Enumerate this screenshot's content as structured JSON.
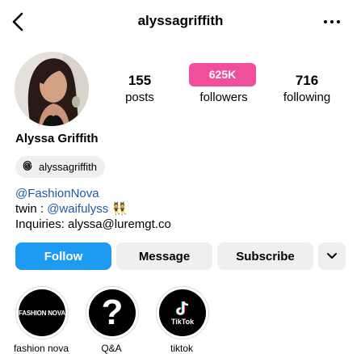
{
  "header": {
    "username": "alyssagriffith"
  },
  "stats": {
    "posts_count": "155",
    "posts_label": "posts",
    "followers_count": "625K",
    "followers_label": "followers",
    "following_count": "716",
    "following_label": "following"
  },
  "profile": {
    "name": "Alyssa Griffith",
    "threads_handle": "alyssagriffith",
    "bio_line1": "@FashionNova",
    "bio_line2_prefix": "twin : ",
    "bio_line2_link": "@waifulyss",
    "bio_line2_emoji": "👯",
    "bio_line3": "Inquiries: alyssa@luremgt.co"
  },
  "actions": {
    "follow": "Follow",
    "message": "Message",
    "subscribe": "Subscribe"
  },
  "highlights": [
    {
      "label": "fashion nova",
      "cover_text": "FASHION NOVA"
    },
    {
      "label": "Q&A",
      "cover_text": "?"
    },
    {
      "label": "tiktok",
      "cover_text": "TikTok"
    }
  ],
  "colors": {
    "follow_blue": "#1d9bf0",
    "badge_pink": "#ef4f9b",
    "link_blue": "#1e5aa8"
  }
}
